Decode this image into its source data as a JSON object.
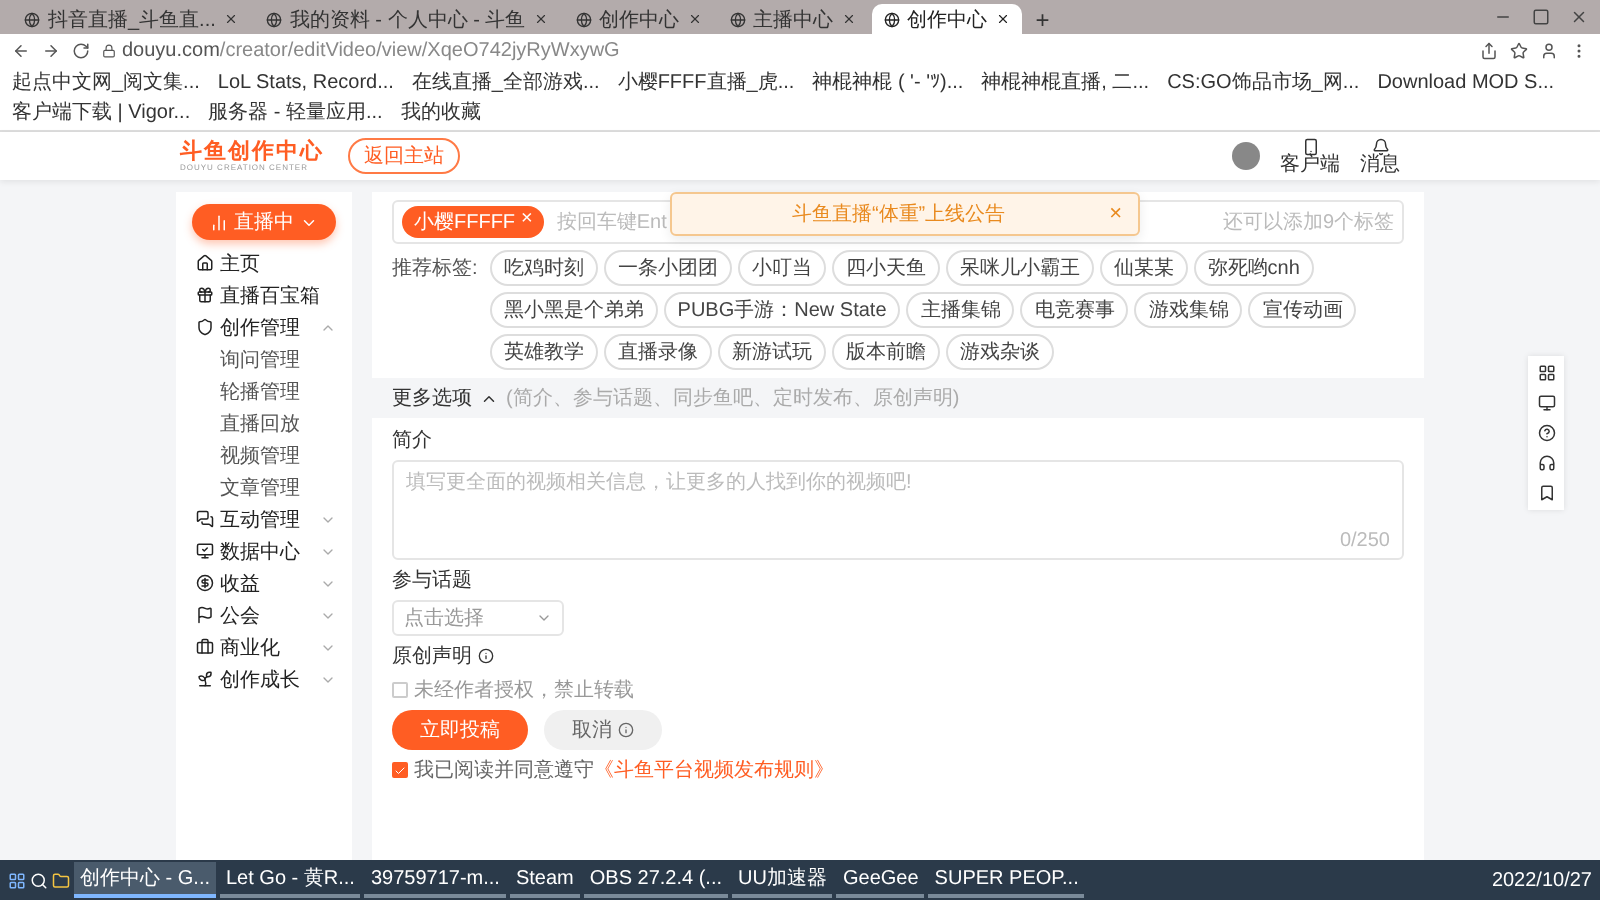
{
  "browser": {
    "tabs": [
      {
        "title": "抖音直播_斗鱼直...",
        "selected": false
      },
      {
        "title": "我的资料 - 个人中心 - 斗鱼",
        "selected": false
      },
      {
        "title": "创作中心",
        "selected": false
      },
      {
        "title": "主播中心",
        "selected": false
      },
      {
        "title": "创作中心",
        "selected": true
      }
    ],
    "new_tab": "+",
    "address": {
      "host": "douyu.com",
      "path": "/creator/editVideo/view/XqeO742jyRyWxywG"
    },
    "bookmarks": [
      "起点中文网_阅文集...",
      "LoL Stats, Record...",
      "在线直播_全部游戏...",
      "小樱FFFF直播_虎...",
      "神棍神棍 ( '- 'ﾂ)...",
      "神棍神棍直播, 二...",
      "CS:GO饰品市场_网...",
      "Download MOD S...",
      "客户端下载 | Vigor...",
      "服务器 - 轻量应用...",
      "我的收藏"
    ]
  },
  "header": {
    "logo_title": "斗鱼创作中心",
    "logo_subtitle": "DOUYU CREATION CENTER",
    "back_button": "返回主站",
    "actions": [
      {
        "label": "客户端"
      },
      {
        "label": "消息"
      }
    ]
  },
  "sidebar": {
    "live_button": "直播中",
    "items": [
      {
        "kind": "link",
        "label": "主页"
      },
      {
        "kind": "link",
        "label": "直播百宝箱"
      },
      {
        "kind": "group",
        "label": "创作管理",
        "expanded": true,
        "children": [
          {
            "label": "询问管理"
          },
          {
            "label": "轮播管理"
          },
          {
            "label": "直播回放"
          },
          {
            "label": "视频管理"
          },
          {
            "label": "文章管理"
          }
        ]
      },
      {
        "kind": "group",
        "label": "互动管理",
        "expanded": false
      },
      {
        "kind": "group",
        "label": "数据中心",
        "expanded": false
      },
      {
        "kind": "group",
        "label": "收益",
        "expanded": false
      },
      {
        "kind": "group",
        "label": "公会",
        "expanded": false
      },
      {
        "kind": "group",
        "label": "商业化",
        "expanded": false
      },
      {
        "kind": "group",
        "label": "创作成长",
        "expanded": false
      }
    ]
  },
  "tags": {
    "chips": [
      {
        "label": "小樱FFFFF",
        "remove": "×"
      }
    ],
    "placeholder": "按回车键Ent",
    "remaining": "还可以添加9个标签",
    "recommended_label": "推荐标签:",
    "recommended": [
      "吃鸡时刻",
      "一条小团团",
      "小叮当",
      "四小天鱼",
      "呆咪儿小霸王",
      "仙某某",
      "弥死哟cnh",
      "黑小黑是个弟弟",
      "PUBG手游：New State",
      "主播集锦",
      "电竞赛事",
      "游戏集锦",
      "宣传动画",
      "英雄教学",
      "直播录像",
      "新游试玩",
      "版本前瞻",
      "游戏杂谈"
    ]
  },
  "toast": {
    "text": "斗鱼直播“体重”上线公告",
    "close": "×"
  },
  "more_options": {
    "label": "更多选项",
    "expanded": true,
    "hint": "(简介、参与话题、同步鱼吧、定时发布、原创声明)"
  },
  "intro": {
    "label": "简介",
    "placeholder": "填写更全面的视频相关信息，让更多的人找到你的视频吧!",
    "counter": "0/250"
  },
  "topic": {
    "label": "参与话题",
    "placeholder": "点击选择"
  },
  "original": {
    "label": "原创声明",
    "option": "未经作者授权，禁止转载",
    "checked": false
  },
  "actions": {
    "submit": "立即投稿",
    "cancel": "取消"
  },
  "agreement": {
    "checked": true,
    "text": "我已阅读并同意遵守",
    "link": "《斗鱼平台视频发布规则》"
  },
  "taskbar": {
    "apps": [
      {
        "label": "创作中心 - G...",
        "selected": true
      },
      {
        "label": "Let Go - 黄R...",
        "selected": false
      },
      {
        "label": "39759717-m...",
        "selected": false
      },
      {
        "label": "Steam",
        "selected": false
      },
      {
        "label": "OBS 27.2.4 (...",
        "selected": false
      },
      {
        "label": "UU加速器",
        "selected": false
      },
      {
        "label": "GeeGee",
        "selected": false
      },
      {
        "label": "SUPER PEOP...",
        "selected": false
      }
    ],
    "date": "2022/10/27"
  }
}
